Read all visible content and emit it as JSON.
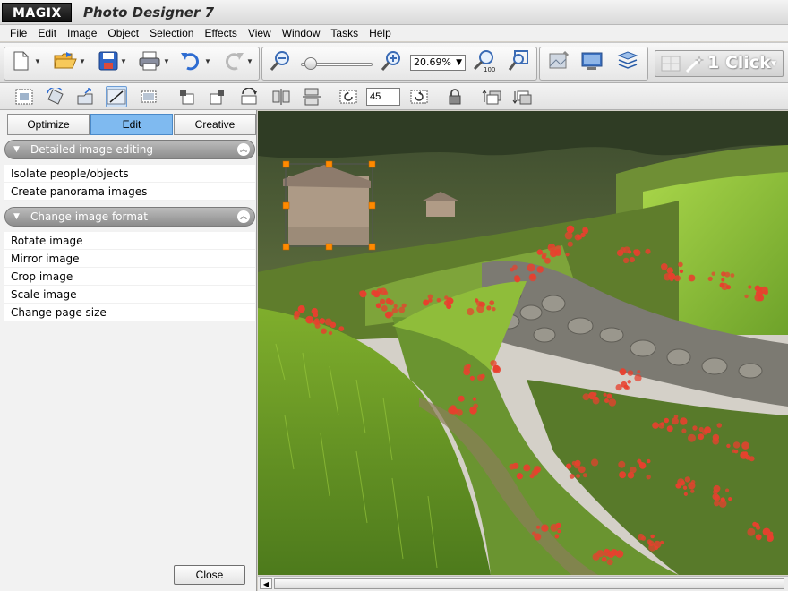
{
  "app": {
    "logo": "MAGIX",
    "title": "Photo Designer 7"
  },
  "menu": [
    "File",
    "Edit",
    "Image",
    "Object",
    "Selection",
    "Effects",
    "View",
    "Window",
    "Tasks",
    "Help"
  ],
  "toolbar": {
    "zoom_value": "20.69%",
    "one_click_label": "1 Click"
  },
  "toolbar2": {
    "rotation_angle": "45"
  },
  "panel": {
    "tabs": [
      {
        "label": "Optimize",
        "active": false
      },
      {
        "label": "Edit",
        "active": true
      },
      {
        "label": "Creative",
        "active": false
      }
    ],
    "sections": [
      {
        "title": "Detailed image editing",
        "items": [
          "Isolate people/objects",
          "Create panorama images"
        ]
      },
      {
        "title": "Change image format",
        "items": [
          "Rotate image",
          "Mirror image",
          "Crop image",
          "Scale image",
          "Change page size"
        ]
      }
    ],
    "close_label": "Close"
  },
  "colors": {
    "active_tab": "#7fbaf0",
    "selection_handle": "#ff8a00",
    "section_header": "#9c9c9c"
  }
}
